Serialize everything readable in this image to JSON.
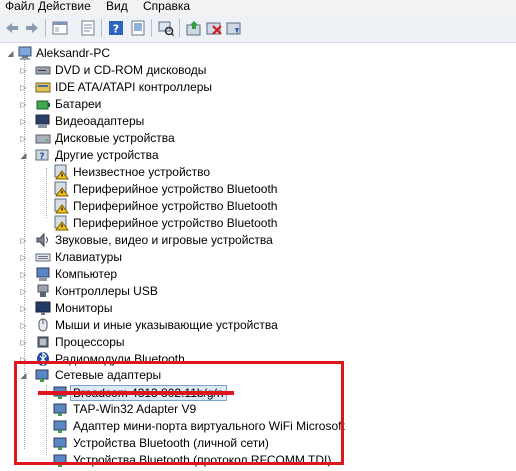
{
  "menu": [
    "Файл",
    "Действие",
    "Вид",
    "Справка"
  ],
  "toolbar_icons": [
    "back-arrow-icon",
    "forward-arrow-icon",
    "show-hide-tree-icon",
    "properties-icon",
    "help-icon",
    "help-topics-icon",
    "scan-hardware-icon",
    "update-driver-icon",
    "disable-device-icon",
    "uninstall-device-icon"
  ],
  "tree": {
    "computer": "Aleksandr-PC",
    "categories": [
      {
        "label": "DVD и CD-ROM дисководы",
        "icon": "dvd-drive-icon"
      },
      {
        "label": "IDE ATA/ATAPI контроллеры",
        "icon": "ide-controller-icon"
      },
      {
        "label": "Батареи",
        "icon": "battery-icon"
      },
      {
        "label": "Видеоадаптеры",
        "icon": "display-adapter-icon"
      },
      {
        "label": "Дисковые устройства",
        "icon": "disk-drive-icon"
      },
      {
        "label": "Другие устройства",
        "icon": "other-devices-icon",
        "expanded": true,
        "children": [
          "Неизвестное устройство",
          "Периферийное устройство Bluetooth",
          "Периферийное устройство Bluetooth",
          "Периферийное устройство Bluetooth"
        ]
      },
      {
        "label": "Звуковые, видео и игровые устройства",
        "icon": "sound-icon"
      },
      {
        "label": "Клавиатуры",
        "icon": "keyboard-icon"
      },
      {
        "label": "Компьютер",
        "icon": "computer-icon"
      },
      {
        "label": "Контроллеры USB",
        "icon": "usb-icon"
      },
      {
        "label": "Мониторы",
        "icon": "monitor-icon"
      },
      {
        "label": "Мыши и иные указывающие устройства",
        "icon": "mouse-icon"
      },
      {
        "label": "Процессоры",
        "icon": "processor-icon"
      },
      {
        "label": "Радиомодули Bluetooth",
        "icon": "bluetooth-icon"
      },
      {
        "label": "Сетевые адаптеры",
        "icon": "network-adapter-icon",
        "expanded": true,
        "children": [
          "Broadcom 4313 802.11b/g/n",
          "TAP-Win32 Adapter V9",
          "Адаптер мини-порта виртуального WiFi Microsoft",
          "Устройства Bluetooth (личной сети)",
          "Устройства Bluetooth (протокол RFCOMM TDI)"
        ]
      }
    ],
    "selected": "Broadcom 4313 802.11b/g/n"
  },
  "colors": {
    "highlight": "#e0141d",
    "selection": "#dbe9f8"
  }
}
